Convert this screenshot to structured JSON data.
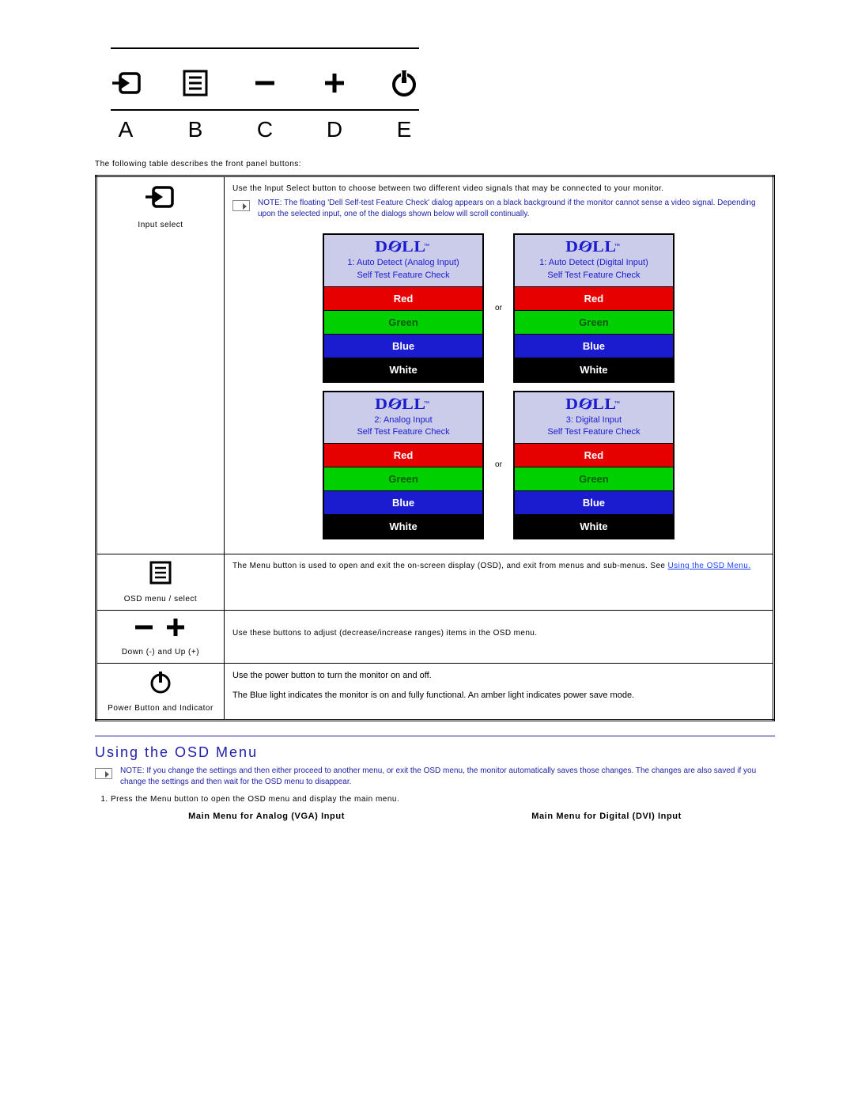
{
  "front_panel": {
    "labels": [
      "A",
      "B",
      "C",
      "D",
      "E"
    ]
  },
  "intro": "The following table describes the front panel buttons:",
  "rows": {
    "input_select": {
      "caption": "Input select",
      "desc": "Use the Input Select button to choose between two different video signals that may be connected to your monitor.",
      "note": "NOTE: The floating 'Dell Self-test Feature Check' dialog appears on a black background if the monitor cannot sense a video signal. Depending upon the selected input, one of the dialogs shown below will scroll continually.",
      "or": "or",
      "boxes": [
        {
          "line1": "1: Auto Detect (Analog Input)",
          "line2": "Self Test  Feature Check"
        },
        {
          "line1": "1: Auto Detect (Digital Input)",
          "line2": "Self Test  Feature Check"
        },
        {
          "line1": "2: Analog Input",
          "line2": "Self Test  Feature Check"
        },
        {
          "line1": "3: Digital Input",
          "line2": "Self Test  Feature Check"
        }
      ],
      "bars": {
        "red": "Red",
        "green": "Green",
        "blue": "Blue",
        "white": "White"
      }
    },
    "osd_menu": {
      "caption": "OSD menu / select",
      "desc": "The Menu button is used to open and exit the on-screen display (OSD), and exit from menus and sub-menus. See ",
      "link": "Using the OSD Menu."
    },
    "down_up": {
      "caption": "Down (-) and Up (+)",
      "desc": "Use these buttons to adjust (decrease/increase ranges) items in the OSD menu."
    },
    "power": {
      "caption": "Power Button and Indicator",
      "line1": "Use the power button to turn the monitor on and off.",
      "line2": "The Blue light indicates the monitor is on and fully functional. An amber light indicates power save mode."
    }
  },
  "osd_section": {
    "heading": "Using the OSD Menu",
    "note": "NOTE: If you change the settings and then either proceed to another menu, or exit the OSD menu, the monitor automatically saves those changes. The changes are also saved if you change the settings and then wait for the OSD menu to disappear.",
    "step1": "Press the Menu button to open the OSD menu and display the main menu.",
    "mm_analog": "Main Menu for Analog (VGA) Input",
    "mm_digital": "Main Menu for Digital (DVI) Input"
  }
}
